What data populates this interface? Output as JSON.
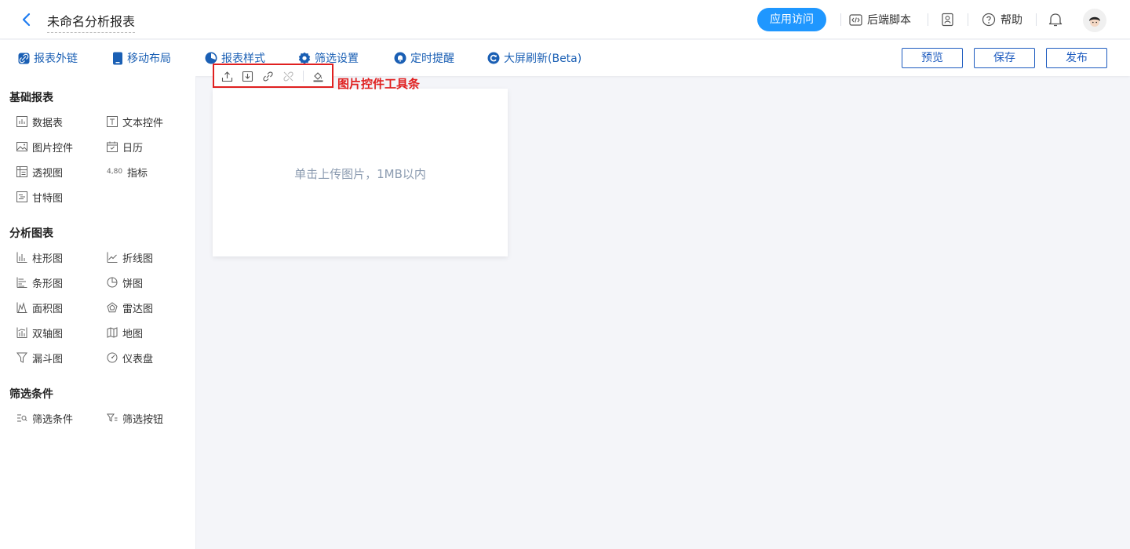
{
  "header": {
    "title": "未命名分析报表",
    "access_button": "应用访问",
    "backend_script": "后端脚本",
    "help": "帮助"
  },
  "toolbar": {
    "items": [
      "报表外链",
      "移动布局",
      "报表样式",
      "筛选设置",
      "定时提醒",
      "大屏刷新(Beta)"
    ],
    "preview": "预览",
    "save": "保存",
    "publish": "发布"
  },
  "sidebar": {
    "sections": [
      {
        "title": "基础报表",
        "items": [
          "数据表",
          "文本控件",
          "图片控件",
          "日历",
          "透视图",
          "指标",
          "甘特图"
        ]
      },
      {
        "title": "分析图表",
        "items": [
          "柱形图",
          "折线图",
          "条形图",
          "饼图",
          "面积图",
          "雷达图",
          "双轴图",
          "地图",
          "漏斗图",
          "仪表盘"
        ]
      },
      {
        "title": "筛选条件",
        "items": [
          "筛选条件",
          "筛选按钮"
        ]
      }
    ],
    "metric_icon_text": "4,80"
  },
  "canvas": {
    "image_placeholder": "单击上传图片，1MB以内",
    "annotation": "图片控件工具条"
  },
  "colors": {
    "accent": "#1f97ff",
    "brand_blue": "#1a5fb4",
    "annotation_red": "#e02020"
  }
}
